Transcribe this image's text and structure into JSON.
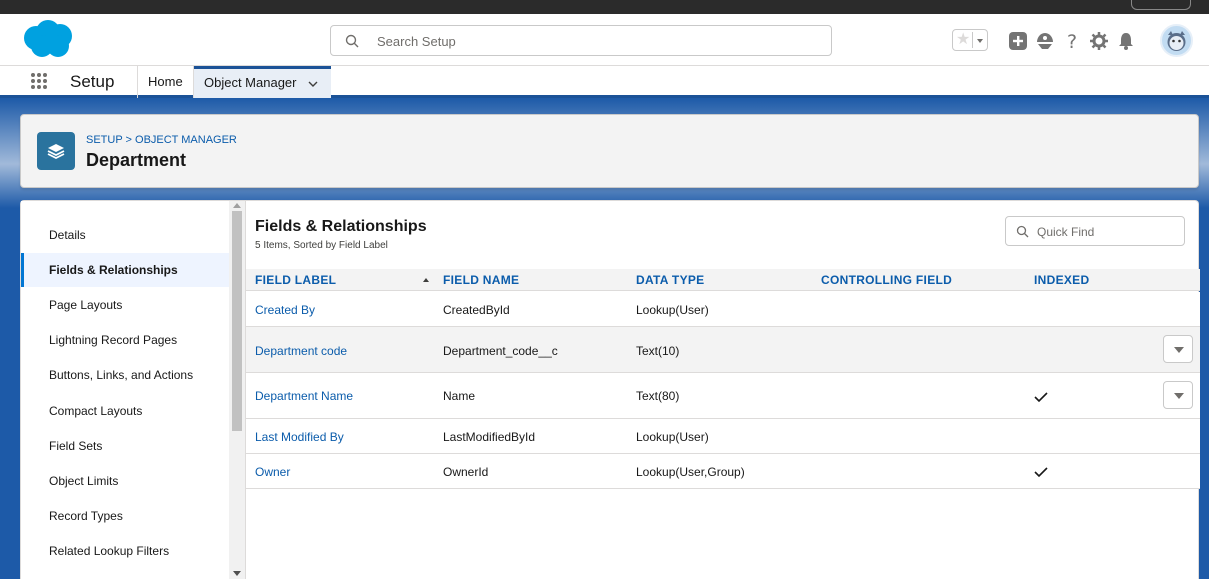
{
  "header": {
    "search_placeholder": "Search Setup"
  },
  "app_nav": {
    "app_name": "Setup",
    "tabs": [
      {
        "label": "Home"
      },
      {
        "label": "Object Manager"
      }
    ]
  },
  "page_header": {
    "breadcrumb": "SETUP > OBJECT MANAGER",
    "title": "Department"
  },
  "sidebar": {
    "items": [
      {
        "label": "Details"
      },
      {
        "label": "Fields & Relationships"
      },
      {
        "label": "Page Layouts"
      },
      {
        "label": "Lightning Record Pages"
      },
      {
        "label": "Buttons, Links, and Actions"
      },
      {
        "label": "Compact Layouts"
      },
      {
        "label": "Field Sets"
      },
      {
        "label": "Object Limits"
      },
      {
        "label": "Record Types"
      },
      {
        "label": "Related Lookup Filters"
      }
    ],
    "active_index": 1
  },
  "content": {
    "title": "Fields & Relationships",
    "subtitle": "5 Items, Sorted by Field Label",
    "quick_find_placeholder": "Quick Find",
    "columns": [
      "FIELD LABEL",
      "FIELD NAME",
      "DATA TYPE",
      "CONTROLLING FIELD",
      "INDEXED"
    ],
    "rows": [
      {
        "label": "Created By",
        "name": "CreatedById",
        "type": "Lookup(User)",
        "controlling": "",
        "indexed": false,
        "menu": false
      },
      {
        "label": "Department code",
        "name": "Department_code__c",
        "type": "Text(10)",
        "controlling": "",
        "indexed": false,
        "menu": true
      },
      {
        "label": "Department Name",
        "name": "Name",
        "type": "Text(80)",
        "controlling": "",
        "indexed": true,
        "menu": true
      },
      {
        "label": "Last Modified By",
        "name": "LastModifiedById",
        "type": "Lookup(User)",
        "controlling": "",
        "indexed": false,
        "menu": false
      },
      {
        "label": "Owner",
        "name": "OwnerId",
        "type": "Lookup(User,Group)",
        "controlling": "",
        "indexed": true,
        "menu": false
      }
    ]
  },
  "colors": {
    "brand_blue": "#0b5cab",
    "nav_blue": "#1b5297",
    "salesforce_cloud": "#00a1e0"
  }
}
